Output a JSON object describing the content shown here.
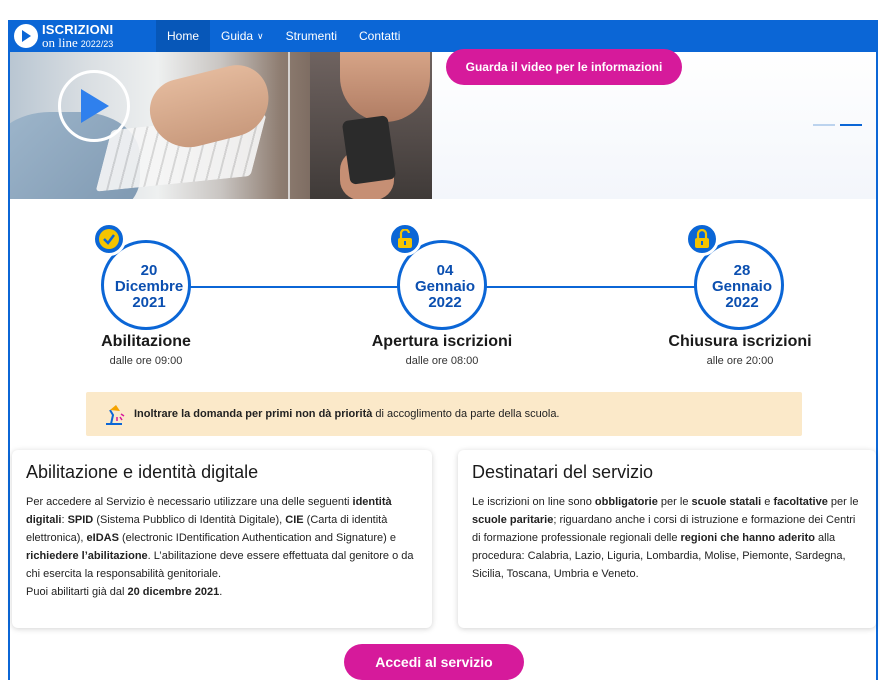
{
  "nav": {
    "logo_line1": "ISCRIZIONI",
    "logo_line2": "on line",
    "logo_year": "2022/23",
    "items": [
      {
        "label": "Home",
        "active": true
      },
      {
        "label": "Guida",
        "dropdown": true
      },
      {
        "label": "Strumenti"
      },
      {
        "label": "Contatti"
      }
    ]
  },
  "hero": {
    "button": "Guarda il video per le informazioni",
    "slides": 2,
    "active_slide": 2
  },
  "timeline": [
    {
      "day": "20",
      "month": "Dicembre",
      "year": "2021",
      "title": "Abilitazione",
      "subtitle": "dalle ore 09:00",
      "icon": "check-icon",
      "status": "done"
    },
    {
      "day": "04",
      "month": "Gennaio",
      "year": "2022",
      "title": "Apertura iscrizioni",
      "subtitle": "dalle ore 08:00",
      "icon": "padlock-open-icon",
      "status": "open"
    },
    {
      "day": "28",
      "month": "Gennaio",
      "year": "2022",
      "title": "Chiusura iscrizioni",
      "subtitle": "alle ore 20:00",
      "icon": "padlock-closed-icon",
      "status": "locked"
    }
  ],
  "notice": {
    "bold": "Inoltrare la domanda per primi non dà priorità",
    "rest": " di accoglimento da parte della scuola.",
    "icon": "lamp-icon"
  },
  "card_left": {
    "title": "Abilitazione e identità digitale",
    "t1": "Per accedere al Servizio è necessario utilizzare una delle seguenti ",
    "b1": "identità digitali",
    "t2": ": ",
    "b2": "SPID",
    "t3": " (Sistema Pubblico di Identità Digitale), ",
    "b3": "CIE",
    "t4": " (Carta di identità elettronica), ",
    "b4": "eIDAS",
    "t5": " (electronic IDentification Authentication and Signature) e ",
    "b5": "richiedere l’abilitazione",
    "t6": ". L’abilitazione deve essere effettuata dal genitore o da chi esercita la responsabilità genitoriale.",
    "t7": "Puoi abilitarti già dal ",
    "b6": "20 dicembre 2021",
    "t8": "."
  },
  "card_right": {
    "title": "Destinatari del servizio",
    "t1": "Le iscrizioni on line sono ",
    "b1": "obbligatorie",
    "t2": " per le ",
    "b2": "scuole statali",
    "t3": " e ",
    "b3": "facoltative",
    "t4": " per le ",
    "b4": "scuole paritarie",
    "t5": "; riguardano anche i corsi di istruzione e formazione dei Centri di formazione professionale regionali delle ",
    "b5": "regioni che hanno aderito",
    "t6": " alla procedura: Calabria, Lazio, Liguria, Lombardia, Molise, Piemonte, Sardegna, Sicilia, Toscana, Umbria e Veneto."
  },
  "cta": {
    "label": "Accedi al servizio"
  },
  "colors": {
    "primary": "#0b66d6",
    "accent": "#d61a9b",
    "notice_bg": "#fbe9c9",
    "badge_yellow": "#f5c400"
  }
}
